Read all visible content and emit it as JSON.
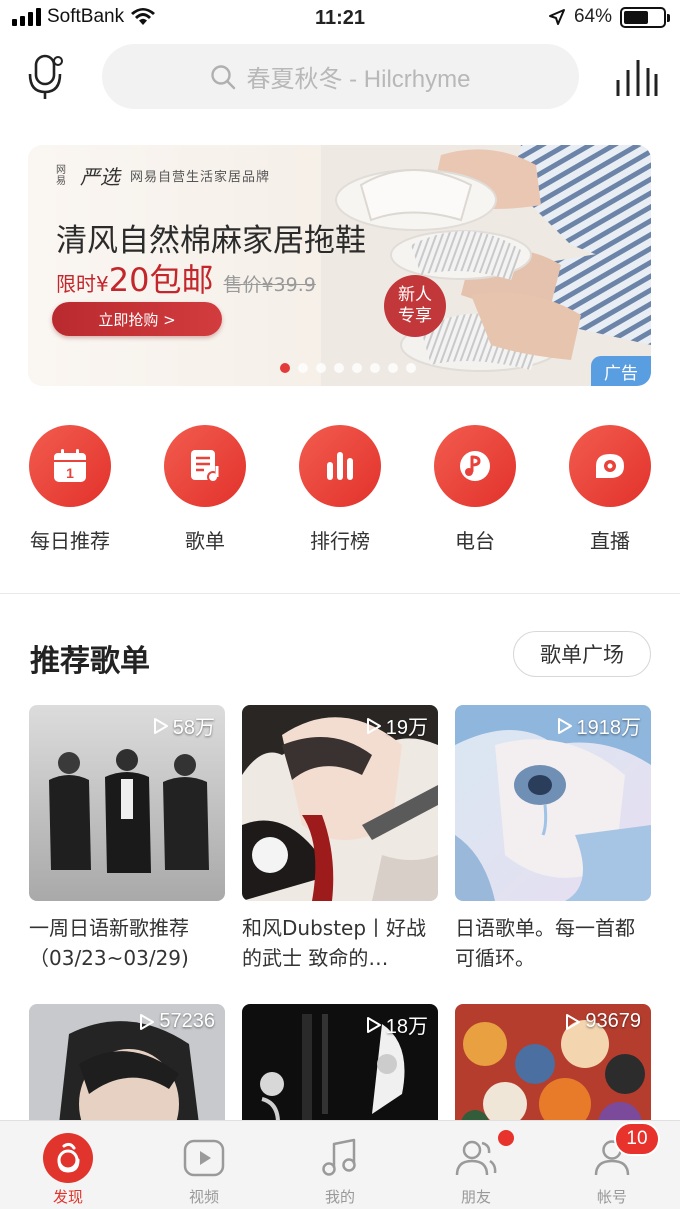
{
  "status_bar": {
    "carrier": "SoftBank",
    "time": "11:21",
    "battery_percent": "64%",
    "battery_level": 0.64
  },
  "header": {
    "search_placeholder": "春夏秋冬 - Hilcrhyme",
    "icons": [
      "mic-icon",
      "search-icon",
      "equalizer-icon"
    ]
  },
  "banner": {
    "brand_small": "网易",
    "brand_name": "严选",
    "brand_tag": "网易自营生活家居品牌",
    "title": "清风自然棉麻家居拖鞋",
    "deal_prefix": "限时¥",
    "deal_price": "20包邮",
    "old_price": "售价¥39.9",
    "button": "立即抢购 >",
    "badge": "新人专享",
    "ad_tag": "广告",
    "slide_count": 8,
    "active_slide": 0
  },
  "quick_nav": [
    {
      "label": "每日推荐",
      "icon": "calendar-icon"
    },
    {
      "label": "歌单",
      "icon": "playlist-icon"
    },
    {
      "label": "排行榜",
      "icon": "chart-bars-icon"
    },
    {
      "label": "电台",
      "icon": "radio-icon"
    },
    {
      "label": "直播",
      "icon": "live-icon"
    }
  ],
  "section": {
    "title": "推荐歌单",
    "more_button": "歌单广场"
  },
  "playlists": [
    {
      "count": "58万",
      "title": "一周日语新歌推荐（03/23~03/29)"
    },
    {
      "count": "19万",
      "title": "和风Dubstep丨好战的武士 致命的…"
    },
    {
      "count": "1918万",
      "title": "日语歌单。每一首都可循环。"
    },
    {
      "count": "57236",
      "title": ""
    },
    {
      "count": "18万",
      "title": ""
    },
    {
      "count": "93679",
      "title": ""
    }
  ],
  "tabs": [
    {
      "label": "发现",
      "icon": "discover-icon",
      "active": true
    },
    {
      "label": "视频",
      "icon": "video-icon",
      "active": false
    },
    {
      "label": "我的",
      "icon": "music-note-icon",
      "active": false
    },
    {
      "label": "朋友",
      "icon": "friends-icon",
      "active": false
    },
    {
      "label": "帐号",
      "icon": "account-icon",
      "active": false
    }
  ],
  "badges": {
    "account_count": "10"
  },
  "colors": {
    "accent": "#e2322c",
    "ad_tag": "#5a9ee2"
  }
}
